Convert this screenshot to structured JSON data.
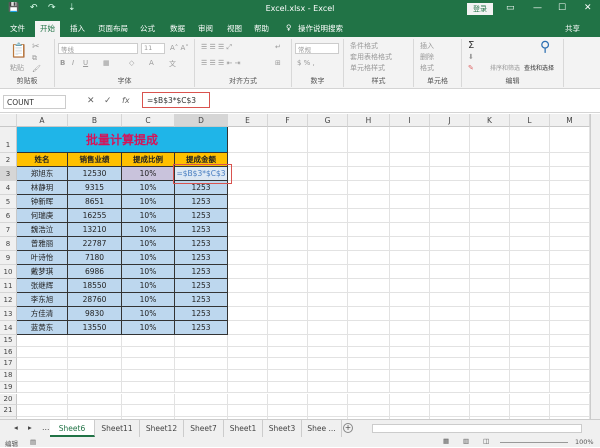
{
  "window": {
    "title": "Excel.xlsx  -  Excel",
    "login": "登录"
  },
  "menu": {
    "tabs": [
      "文件",
      "开始",
      "插入",
      "页面布局",
      "公式",
      "数据",
      "审阅",
      "视图",
      "帮助"
    ],
    "active": "开始",
    "search": "操作说明搜索",
    "share": "共享"
  },
  "ribbon": {
    "groups": [
      "剪贴板",
      "字体",
      "对齐方式",
      "数字",
      "样式",
      "单元格",
      "编辑"
    ],
    "paste": "粘贴",
    "font_name": "等线",
    "font_size": "11",
    "number_format": "常规",
    "styles": [
      "条件格式",
      "套用表格格式",
      "单元格样式"
    ],
    "cells": [
      "插入",
      "删除",
      "格式"
    ],
    "sort": "排序和筛选",
    "find": "查找和选择"
  },
  "formula_bar": {
    "name_box": "COUNT",
    "formula": "=$B$3*$C$3"
  },
  "columns": [
    "A",
    "B",
    "C",
    "D",
    "E",
    "F",
    "G",
    "H",
    "I",
    "J",
    "K",
    "L",
    "M"
  ],
  "table": {
    "title": "批量计算提成",
    "headers": [
      "姓名",
      "销售业绩",
      "提成比例",
      "提成金额"
    ],
    "rows": [
      [
        "郑旭东",
        "12530",
        "10%",
        "=$B$3*$C$3"
      ],
      [
        "林静玥",
        "9315",
        "10%",
        "1253"
      ],
      [
        "钟新晖",
        "8651",
        "10%",
        "1253"
      ],
      [
        "何瑞庚",
        "16255",
        "10%",
        "1253"
      ],
      [
        "魏浩泣",
        "13210",
        "10%",
        "1253"
      ],
      [
        "曾雅丽",
        "22787",
        "10%",
        "1253"
      ],
      [
        "叶诗怡",
        "7180",
        "10%",
        "1253"
      ],
      [
        "戴梦琪",
        "6986",
        "10%",
        "1253"
      ],
      [
        "张继辉",
        "18550",
        "10%",
        "1253"
      ],
      [
        "李东旭",
        "28760",
        "10%",
        "1253"
      ],
      [
        "方佳清",
        "9830",
        "10%",
        "1253"
      ],
      [
        "蓝黄东",
        "13550",
        "10%",
        "1253"
      ]
    ]
  },
  "sheets": [
    "Sheet6",
    "Sheet11",
    "Sheet12",
    "Sheet7",
    "Sheet1",
    "Sheet3",
    "Shee ..."
  ],
  "active_sheet": "Sheet6",
  "status": {
    "mode": "编辑",
    "zoom": "100%"
  },
  "colors": {
    "green": "#217346",
    "title_fill": "#1fb5e8",
    "title_text": "#d4145a",
    "header_fill": "#ffc000",
    "body_fill": "#bdd7ee"
  }
}
